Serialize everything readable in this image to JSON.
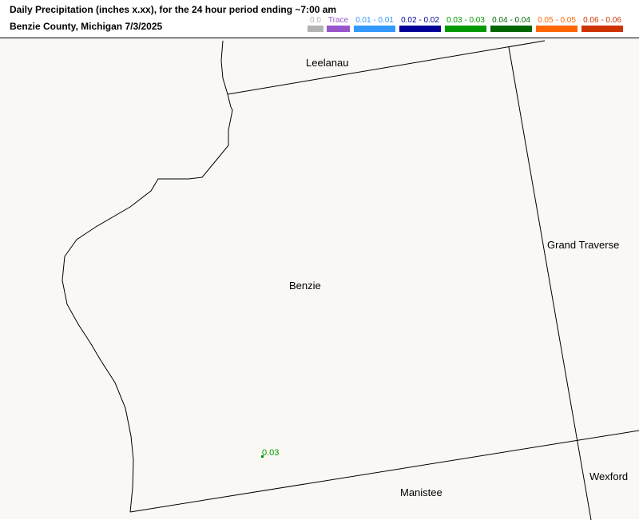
{
  "header": {
    "title_line1": "Daily Precipitation (inches  x.xx),  for the 24 hour period ending ~7:00 am",
    "title_line2": "Benzie County, Michigan  7/3/2025"
  },
  "legend": [
    {
      "label": "0.0",
      "color": "#b3b3b3"
    },
    {
      "label": "Trace",
      "color": "#9955cc"
    },
    {
      "label": "0.01 - 0.01",
      "color": "#3399ff"
    },
    {
      "label": "0.02 - 0.02",
      "color": "#000099"
    },
    {
      "label": "0.03 - 0.03",
      "color": "#009900"
    },
    {
      "label": "0.04 - 0.04",
      "color": "#006600"
    },
    {
      "label": "0.05 - 0.05",
      "color": "#ff6600"
    },
    {
      "label": "0.06 - 0.06",
      "color": "#cc3300"
    }
  ],
  "counties": {
    "leelanau": "Leelanau",
    "grand_traverse": "Grand Traverse",
    "benzie": "Benzie",
    "manistee": "Manistee",
    "wexford": "Wexford"
  },
  "stations": [
    {
      "value": "0.03",
      "color": "#009900"
    }
  ]
}
